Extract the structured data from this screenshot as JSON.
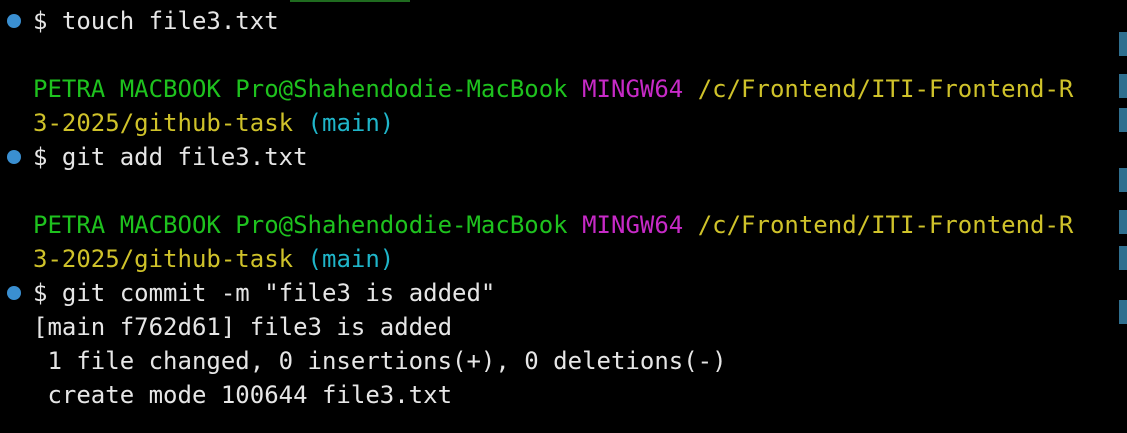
{
  "theme": {
    "background": "#000000",
    "text": "#e6e6e6",
    "user_host": "#1ec21e",
    "system": "#c72ac7",
    "path": "#cfc22a",
    "branch": "#1fb5c9",
    "marker": "#3a8fd1",
    "scrollbar_marker": "#2f6f8f"
  },
  "lines": {
    "l1": {
      "prompt": "$ ",
      "command": "touch file3.txt"
    },
    "l2": {
      "user": "PETRA MACBOOK Pro",
      "at": "@",
      "host": "Shahendodie-MacBook",
      "system": "MINGW64",
      "path": "/c/Frontend/ITI-Frontend-R"
    },
    "l3": {
      "path": "3-2025/github-task",
      "branch": "(main)"
    },
    "l4": {
      "prompt": "$ ",
      "command": "git add file3.txt"
    },
    "l5": {
      "user": "PETRA MACBOOK Pro",
      "at": "@",
      "host": "Shahendodie-MacBook",
      "system": "MINGW64",
      "path": "/c/Frontend/ITI-Frontend-R"
    },
    "l6": {
      "path": "3-2025/github-task",
      "branch": "(main)"
    },
    "l7": {
      "prompt": "$ ",
      "command": "git commit -m \"file3 is added\""
    },
    "l8": {
      "text": "[main f762d61] file3 is added"
    },
    "l9": {
      "text": " 1 file changed, 0 insertions(+), 0 deletions(-)"
    },
    "l10": {
      "text": " create mode 100644 file3.txt"
    }
  },
  "icons": {
    "command_marker": "circle-dot-icon",
    "scroll_mark": "scroll-position-icon"
  }
}
